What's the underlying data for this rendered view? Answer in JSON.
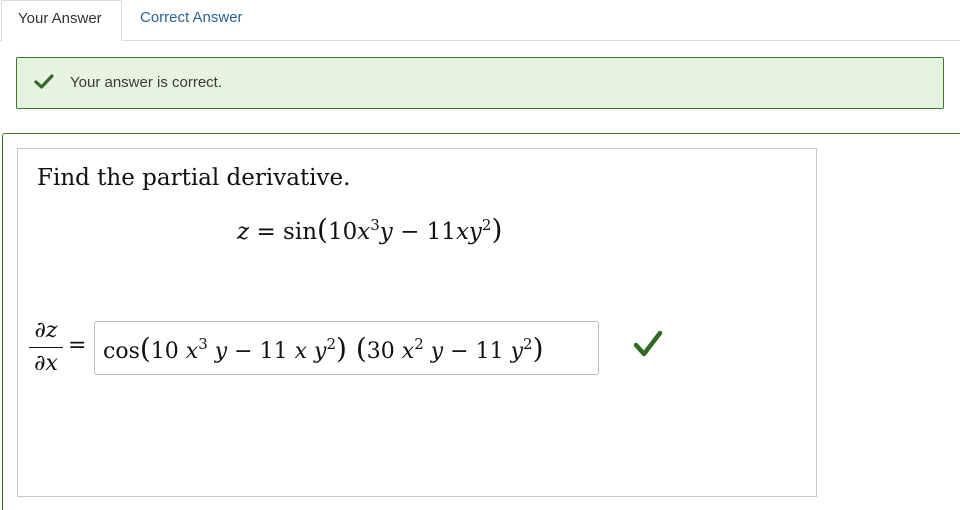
{
  "tabs": {
    "your_answer": "Your Answer",
    "correct_answer": "Correct Answer"
  },
  "feedback": {
    "message": "Your answer is correct.",
    "icon": "check-icon"
  },
  "question": {
    "prompt": "Find the partial derivative.",
    "equation": {
      "lhs": "z",
      "eq": "=",
      "func": "sin",
      "open": "(",
      "t1_coef": "10",
      "t1_var": "x",
      "t1_exp": "3",
      "t1_var2": "y",
      "minus": "−",
      "t2_coef": "11",
      "t2_var": "xy",
      "t2_exp": "2",
      "close": ")"
    },
    "derivative": {
      "numerator": "∂z",
      "denominator": "∂x",
      "equals": "="
    },
    "answer": {
      "func": "cos",
      "open1": "(",
      "a1": "10 ",
      "x1": "x",
      "e1": "3",
      "y1": " y",
      "m1": " − 11 ",
      "x2": "x",
      "y2": " y",
      "e2": "2",
      "close1": ")",
      "open2": " (",
      "a2": "30 ",
      "x3": "x",
      "e3": "2",
      "y3": " y",
      "m2": " − 11 ",
      "y4": "y",
      "e4": "2",
      "close2": ")"
    },
    "status_icon": "check-icon"
  },
  "colors": {
    "success_green": "#3c7a28",
    "success_bg": "#e7f3e1",
    "link_blue": "#2a6496"
  }
}
